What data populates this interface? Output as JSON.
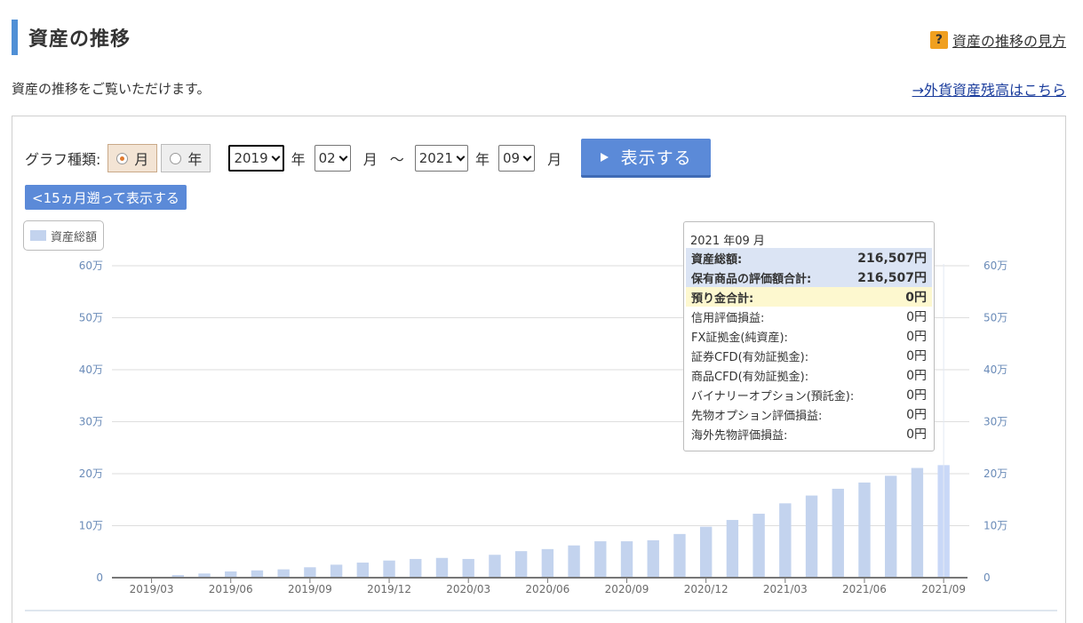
{
  "header": {
    "title": "資産の推移",
    "help_icon": "?",
    "help_link": "資産の推移の見方"
  },
  "intro": "資産の推移をご覧いただけます。",
  "forex_link": "→外貨資産残高はこちら",
  "controls": {
    "graph_type_label": "グラフ種類:",
    "radio_month": "月",
    "radio_year": "年",
    "selected": "月",
    "from_year": "2019",
    "from_month": "02",
    "to_year": "2021",
    "to_month": "09",
    "year_unit": "年",
    "month_unit": "月",
    "tilde": "～",
    "show_button": "表示する",
    "back_button": "<15ヵ月遡って表示する"
  },
  "legend": {
    "label": "資産総額",
    "color": "#c3d3ee"
  },
  "chart_data": {
    "type": "bar",
    "ylim": [
      0,
      600000
    ],
    "y_ticks": [
      {
        "value": 0,
        "label": "0"
      },
      {
        "value": 100000,
        "label": "10万"
      },
      {
        "value": 200000,
        "label": "20万"
      },
      {
        "value": 300000,
        "label": "30万"
      },
      {
        "value": 400000,
        "label": "40万"
      },
      {
        "value": 500000,
        "label": "50万"
      },
      {
        "value": 600000,
        "label": "60万"
      }
    ],
    "x_tick_labels": [
      "2019/03",
      "2019/06",
      "2019/09",
      "2019/12",
      "2020/03",
      "2020/06",
      "2020/09",
      "2020/12",
      "2021/03",
      "2021/06",
      "2021/09"
    ],
    "categories": [
      "2019/02",
      "2019/03",
      "2019/04",
      "2019/05",
      "2019/06",
      "2019/07",
      "2019/08",
      "2019/09",
      "2019/10",
      "2019/11",
      "2019/12",
      "2020/01",
      "2020/02",
      "2020/03",
      "2020/04",
      "2020/05",
      "2020/06",
      "2020/07",
      "2020/08",
      "2020/09",
      "2020/10",
      "2020/11",
      "2020/12",
      "2021/01",
      "2021/02",
      "2021/03",
      "2021/04",
      "2021/05",
      "2021/06",
      "2021/07",
      "2021/08",
      "2021/09"
    ],
    "series": [
      {
        "name": "資産総額",
        "color": "#c3d3ee",
        "highlight_color": "#c9d8f7",
        "values": [
          0,
          0,
          5000,
          8000,
          12000,
          14000,
          16000,
          20000,
          25000,
          29000,
          33000,
          36000,
          38000,
          36000,
          44000,
          51000,
          55000,
          62000,
          70000,
          70000,
          72000,
          84000,
          98000,
          111000,
          123000,
          143000,
          158000,
          171000,
          183000,
          196000,
          211000,
          216507
        ]
      }
    ],
    "highlight_index": 31
  },
  "tooltip": {
    "date": "2021 年09 月",
    "rows": [
      {
        "label": "資産総額:",
        "value": "216,507円",
        "style": "blue"
      },
      {
        "label": "保有商品の評価額合計:",
        "value": "216,507円",
        "style": "blue"
      },
      {
        "label": "預り金合計:",
        "value": "0円",
        "style": "yellow"
      },
      {
        "label": "信用評価損益:",
        "value": "0円",
        "style": "plain"
      },
      {
        "label": "FX証拠金(純資産):",
        "value": "0円",
        "style": "plain"
      },
      {
        "label": "証券CFD(有効証拠金):",
        "value": "0円",
        "style": "plain"
      },
      {
        "label": "商品CFD(有効証拠金):",
        "value": "0円",
        "style": "plain"
      },
      {
        "label": "バイナリーオプション(預託金):",
        "value": "0円",
        "style": "plain"
      },
      {
        "label": "先物オプション評価損益:",
        "value": "0円",
        "style": "plain"
      },
      {
        "label": "海外先物評価損益:",
        "value": "0円",
        "style": "plain"
      }
    ]
  }
}
